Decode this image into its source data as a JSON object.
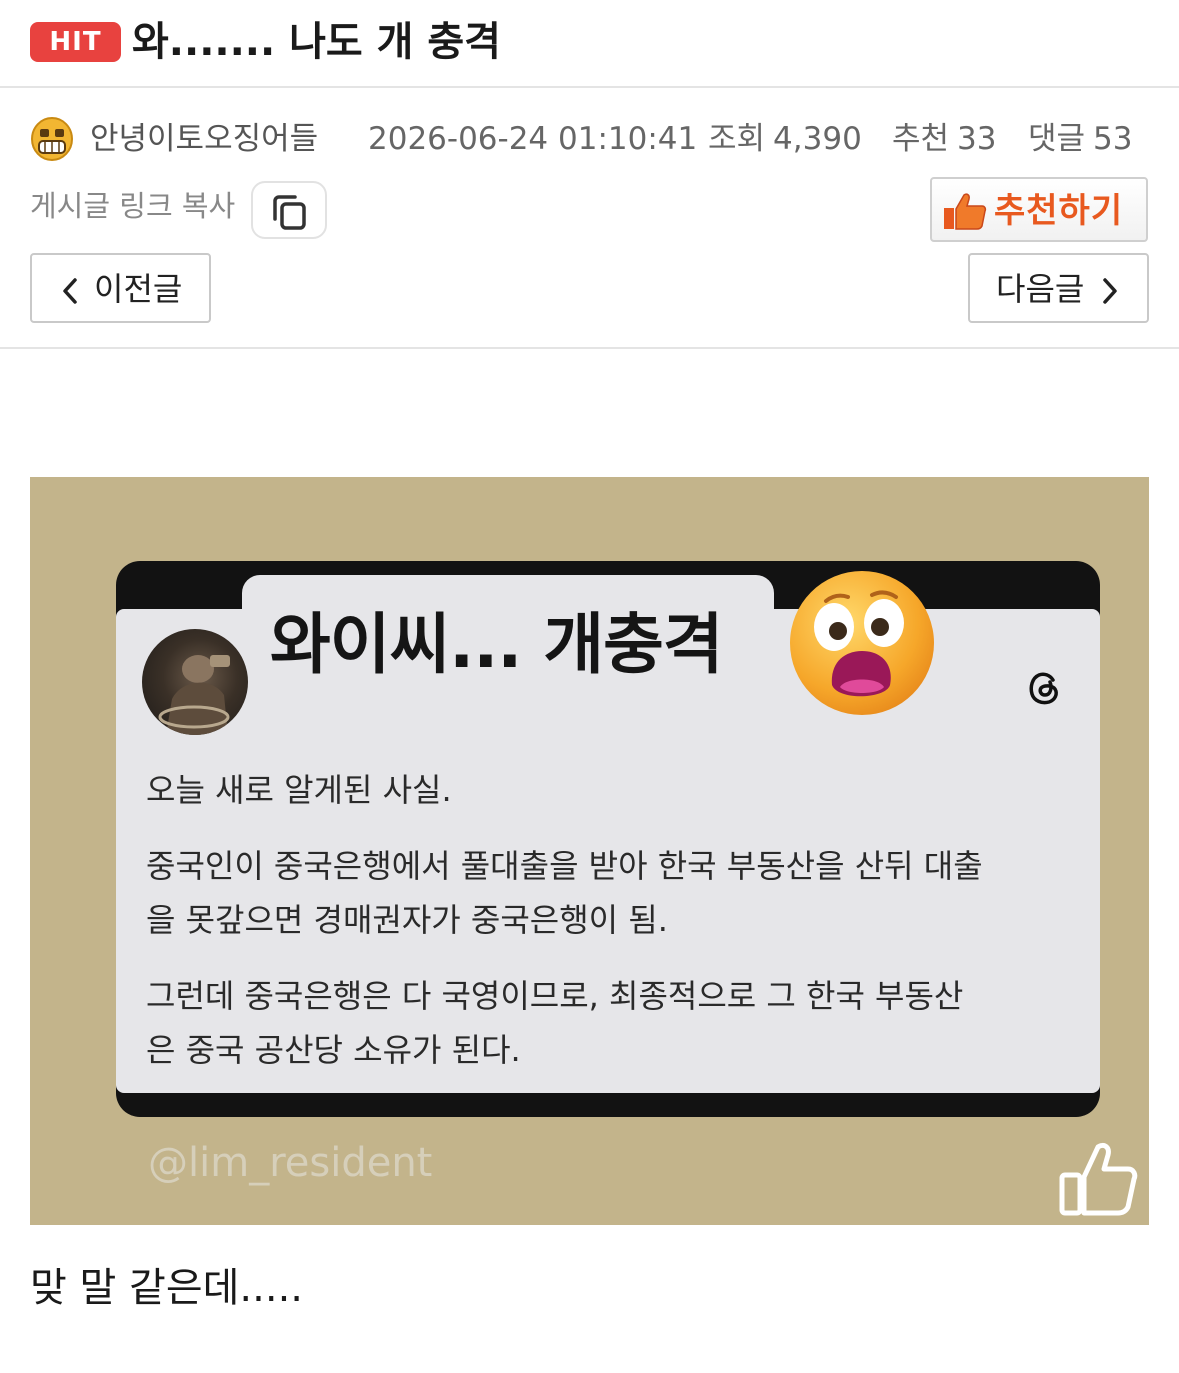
{
  "header": {
    "badge": "HIT",
    "title": "와....... 나도 개 충격"
  },
  "meta": {
    "author": "안녕이토오징어들",
    "date": "2026-06-24 01:10:41",
    "views_label": "조회",
    "views": "4,390",
    "recommend_label": "추천",
    "recommend_count": "33",
    "comments_label": "댓글",
    "comments_count": "53"
  },
  "actions": {
    "copy_link": "게시글 링크 복사",
    "recommend_button": "추천하기",
    "prev": "이전글",
    "next": "다음글"
  },
  "image": {
    "title": "와이씨... 개충격",
    "line1": "오늘 새로 알게된 사실.",
    "para1_l1": "중국인이 중국은행에서 풀대출을 받아 한국 부동산을 산뒤 대출",
    "para1_l2": "을 못갚으면 경매권자가 중국은행이 됨.",
    "para2_l1": "그런데 중국은행은 다 국영이므로, 최종적으로 그 한국 부동산",
    "para2_l2": "은 중국 공산당 소유가 된다.",
    "watermark": "@lim_resident"
  },
  "body": {
    "text": "맞 말 같은데....."
  },
  "colors": {
    "badge_bg": "#e8423f",
    "recommend_text": "#e8591f",
    "image_bg": "#c3b48b",
    "card_bg": "#e6e6e9"
  },
  "icons": [
    "grinning-squinting-avatar-icon",
    "copy-icon",
    "thumbs-up-icon",
    "chevron-left-icon",
    "chevron-right-icon",
    "shocked-face-emoji-icon",
    "threads-logo-icon",
    "like-outline-icon"
  ]
}
